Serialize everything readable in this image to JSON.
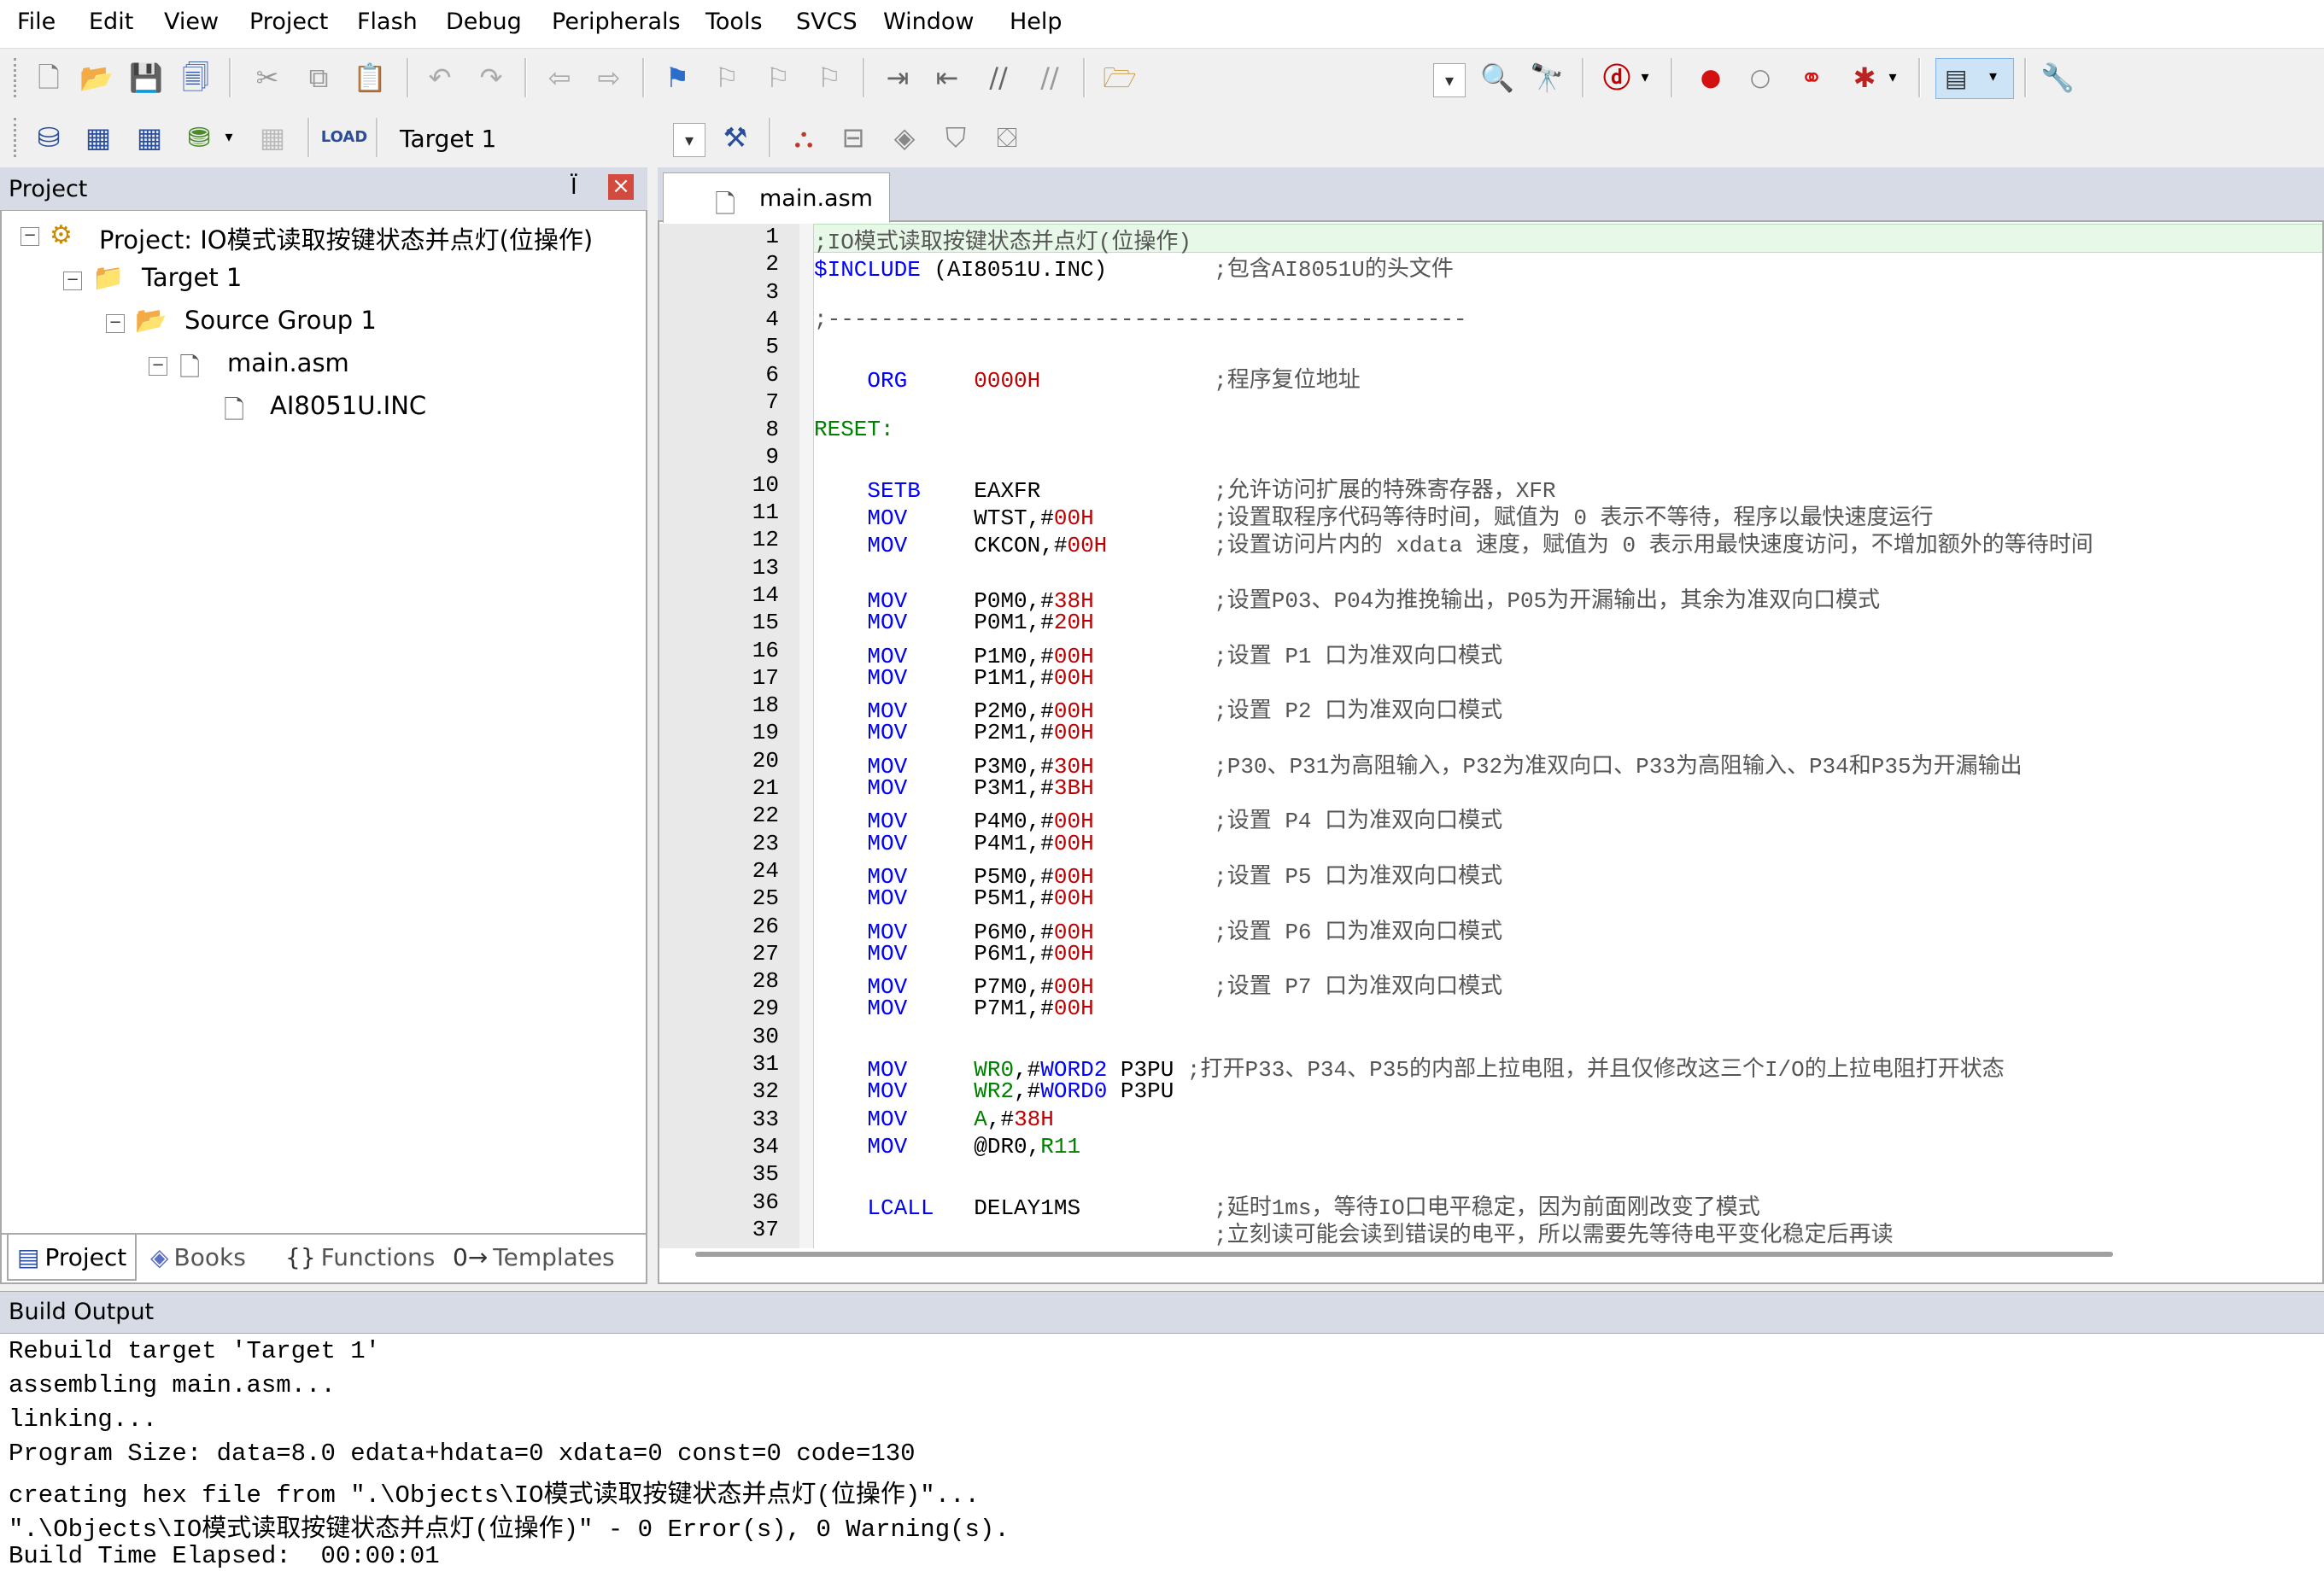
{
  "menu": [
    "File",
    "Edit",
    "View",
    "Project",
    "Flash",
    "Debug",
    "Peripherals",
    "Tools",
    "SVCS",
    "Window",
    "Help"
  ],
  "toolbar2": {
    "target": "Target 1"
  },
  "project_panel": {
    "title": "Project",
    "pin": "Ї",
    "close": "×",
    "tree": {
      "project": "Project: IO模式读取按键状态并点灯(位操作)",
      "target": "Target 1",
      "group": "Source Group 1",
      "file": "main.asm",
      "include": "AI8051U.INC"
    },
    "tabs": [
      "Project",
      "Books",
      "Functions",
      "Templates"
    ]
  },
  "editor": {
    "tab": "main.asm",
    "lines": [
      {
        "n": "1",
        "c": ";IO模式读取按键状态并点灯(位操作)"
      },
      {
        "n": "2",
        "c": "$INCLUDE (AI8051U.INC)        ;包含AI8051U的头文件"
      },
      {
        "n": "3",
        "c": ""
      },
      {
        "n": "4",
        "c": ";------------------------------------------------"
      },
      {
        "n": "5",
        "c": ""
      },
      {
        "n": "6",
        "c": "    ORG     0000H             ;程序复位地址"
      },
      {
        "n": "7",
        "c": ""
      },
      {
        "n": "8",
        "c": "RESET:"
      },
      {
        "n": "9",
        "c": ""
      },
      {
        "n": "10",
        "c": "    SETB    EAXFR             ;允许访问扩展的特殊寄存器，XFR"
      },
      {
        "n": "11",
        "c": "    MOV     WTST,#00H         ;设置取程序代码等待时间，赋值为 0 表示不等待，程序以最快速度运行"
      },
      {
        "n": "12",
        "c": "    MOV     CKCON,#00H        ;设置访问片内的 xdata 速度，赋值为 0 表示用最快速度访问，不增加额外的等待时间"
      },
      {
        "n": "13",
        "c": ""
      },
      {
        "n": "14",
        "c": "    MOV     P0M0,#38H         ;设置P03、P04为推挽输出，P05为开漏输出，其余为准双向口模式"
      },
      {
        "n": "15",
        "c": "    MOV     P0M1,#20H"
      },
      {
        "n": "16",
        "c": "    MOV     P1M0,#00H         ;设置 P1 口为准双向口模式"
      },
      {
        "n": "17",
        "c": "    MOV     P1M1,#00H"
      },
      {
        "n": "18",
        "c": "    MOV     P2M0,#00H         ;设置 P2 口为准双向口模式"
      },
      {
        "n": "19",
        "c": "    MOV     P2M1,#00H"
      },
      {
        "n": "20",
        "c": "    MOV     P3M0,#30H         ;P30、P31为高阻输入，P32为准双向口、P33为高阻输入、P34和P35为开漏输出"
      },
      {
        "n": "21",
        "c": "    MOV     P3M1,#3BH"
      },
      {
        "n": "22",
        "c": "    MOV     P4M0,#00H         ;设置 P4 口为准双向口模式"
      },
      {
        "n": "23",
        "c": "    MOV     P4M1,#00H"
      },
      {
        "n": "24",
        "c": "    MOV     P5M0,#00H         ;设置 P5 口为准双向口模式"
      },
      {
        "n": "25",
        "c": "    MOV     P5M1,#00H"
      },
      {
        "n": "26",
        "c": "    MOV     P6M0,#00H         ;设置 P6 口为准双向口模式"
      },
      {
        "n": "27",
        "c": "    MOV     P6M1,#00H"
      },
      {
        "n": "28",
        "c": "    MOV     P7M0,#00H         ;设置 P7 口为准双向口模式"
      },
      {
        "n": "29",
        "c": "    MOV     P7M1,#00H"
      },
      {
        "n": "30",
        "c": ""
      },
      {
        "n": "31",
        "c": "    MOV     WR0,#WORD2 P3PU ;打开P33、P34、P35的内部上拉电阻，并且仅修改这三个I/O的上拉电阻打开状态"
      },
      {
        "n": "32",
        "c": "    MOV     WR2,#WORD0 P3PU"
      },
      {
        "n": "33",
        "c": "    MOV     A,#38H"
      },
      {
        "n": "34",
        "c": "    MOV     @DR0,R11"
      },
      {
        "n": "35",
        "c": ""
      },
      {
        "n": "36",
        "c": "    LCALL   DELAY1MS          ;延时1ms，等待IO口电平稳定，因为前面刚改变了模式"
      },
      {
        "n": "37",
        "c": "                              ;立刻读可能会读到错误的电平，所以需要先等待电平变化稳定后再读"
      }
    ]
  },
  "build_output": {
    "title": "Build Output",
    "lines": [
      "Rebuild target 'Target 1'",
      "assembling main.asm...",
      "linking...",
      "Program Size: data=8.0 edata+hdata=0 xdata=0 const=0 code=130",
      "creating hex file from \".\\Objects\\IO模式读取按键状态并点灯(位操作)\"...",
      "\".\\Objects\\IO模式读取按键状态并点灯(位操作)\" - 0 Error(s), 0 Warning(s).",
      "Build Time Elapsed:  00:00:01"
    ]
  }
}
